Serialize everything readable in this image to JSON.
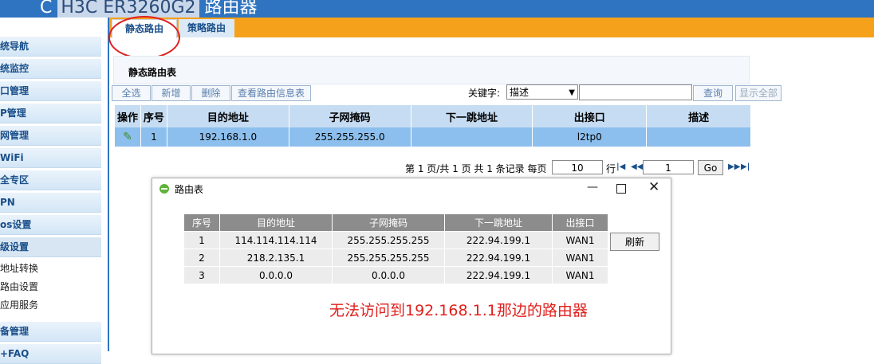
{
  "header": {
    "brand_fragment": "C",
    "model": "H3C ER3260G2",
    "suffix": "路由器"
  },
  "sidebar": {
    "items": [
      "统导航",
      "统监控",
      "口管理",
      "P管理",
      "网管理",
      "WiFi",
      "全专区",
      "PN",
      "os设置",
      "级设置"
    ],
    "sub_items": [
      "地址转换",
      "路由设置",
      "应用服务"
    ],
    "bottom_items": [
      "备管理",
      "+FAQ"
    ]
  },
  "tabs": {
    "static": "静态路由",
    "policy": "策略路由"
  },
  "section": {
    "title": "静态路由表"
  },
  "toolbar": {
    "select_all": "全选",
    "add": "新增",
    "delete": "删除",
    "view_info": "查看路由信息表"
  },
  "search": {
    "label": "关键字:",
    "field": "描述",
    "query": "查询",
    "show_all": "显示全部"
  },
  "table": {
    "headers": [
      "操作",
      "序号",
      "目的地址",
      "子网掩码",
      "下一跳地址",
      "出接口",
      "描述"
    ],
    "rows": [
      {
        "index": "1",
        "dest": "192.168.1.0",
        "mask": "255.255.255.0",
        "next_hop": "",
        "iface": "l2tp0",
        "desc": ""
      }
    ]
  },
  "pager": {
    "text": "第 1 页/共 1 页 共 1 条记录 每页",
    "per_page": "10",
    "row_unit": "行",
    "page": "1",
    "go": "Go"
  },
  "dialog": {
    "title": "路由表",
    "headers": [
      "序号",
      "目的地址",
      "子网掩码",
      "下一跳地址",
      "出接口"
    ],
    "rows": [
      {
        "index": "1",
        "dest": "114.114.114.114",
        "mask": "255.255.255.255",
        "next_hop": "222.94.199.1",
        "iface": "WAN1"
      },
      {
        "index": "2",
        "dest": "218.2.135.1",
        "mask": "255.255.255.255",
        "next_hop": "222.94.199.1",
        "iface": "WAN1"
      },
      {
        "index": "3",
        "dest": "0.0.0.0",
        "mask": "0.0.0.0",
        "next_hop": "222.94.199.1",
        "iface": "WAN1"
      }
    ],
    "refresh": "刷新",
    "note": "无法访问到192.168.1.1那边的路由器"
  },
  "colors": {
    "header": "#2f74c0",
    "tabbar": "#f5a11c",
    "row_selected": "#8cbfee",
    "note": "#e0201c",
    "circle": "#e02020"
  }
}
